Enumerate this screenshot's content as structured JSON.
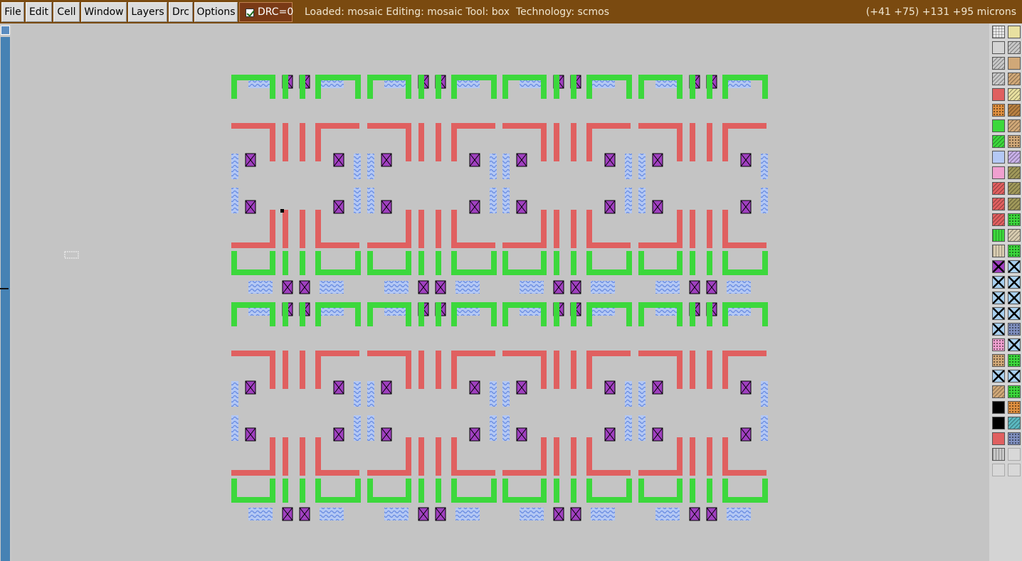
{
  "menu": {
    "items": [
      "File",
      "Edit",
      "Cell",
      "Window",
      "Layers",
      "Drc",
      "Options"
    ]
  },
  "drc": {
    "label": "DRC=0",
    "checked": true
  },
  "status": {
    "text": "Loaded: mosaic Editing: mosaic Tool: box  Technology: scmos",
    "coords": "(+41 +75) +131 +95 microns"
  },
  "colors": {
    "menubar": "#7a4a10",
    "canvas_bg": "#c4c4c4",
    "poly_red": "#e06060",
    "diff_green": "#3cd83c",
    "metal_blue": "#8aa8f0",
    "contact_purple": "#a040c0",
    "scrollbar": "#4682b4"
  },
  "layers": [
    "poly",
    "ndiffusion",
    "metal1",
    "contact"
  ],
  "palette_icons": [
    "grid-pattern",
    "yellow-pattern",
    "box-outline",
    "hatch-pattern",
    "diag-hatch",
    "tan-pattern",
    "dot-hatch",
    "tan-hatch",
    "red-solid",
    "yellow-hatch",
    "orange-dots",
    "brown-hatch",
    "green-solid",
    "tan-hatch-2",
    "green-hatch",
    "tan-dots",
    "blue-wave",
    "lavender-hatch",
    "pink-cross",
    "olive-hatch",
    "red-hatch",
    "olive-hatch-2",
    "red-hatch-2",
    "olive-hatch-3",
    "red-hatch-3",
    "green-dots",
    "green-stripe",
    "beige-hatch",
    "beige-stripe",
    "green-dots-2",
    "purple-contact",
    "cyan-contact",
    "cyan-contact-2",
    "cyan-contact-3",
    "cyan-contact-4",
    "cyan-contact-5",
    "cyan-contact-6",
    "cyan-contact-7",
    "cyan-contact-8",
    "navy-dots",
    "pink-dots",
    "cyan-contact-9",
    "tan-dots-2",
    "green-dots-3",
    "cyan-contact-10",
    "cyan-contact-11",
    "tan-hatch-3",
    "green-dots-4",
    "black-grid",
    "orange-dots-2",
    "black-solid",
    "teal-hatch",
    "red-solid-2",
    "navy-dots-2",
    "gray-lines",
    "blank",
    "blank-2",
    "blank-3"
  ]
}
